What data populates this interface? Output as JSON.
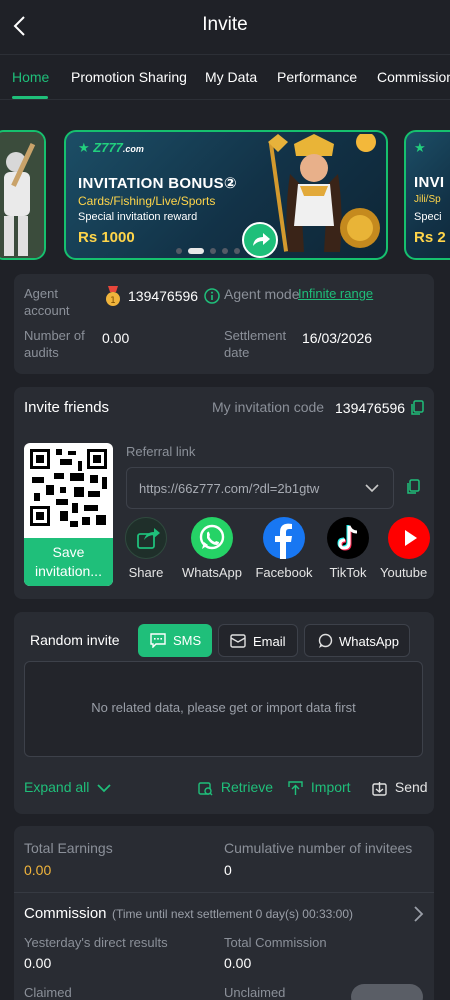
{
  "header": {
    "title": "Invite"
  },
  "tabs": [
    "Home",
    "Promotion Sharing",
    "My Data",
    "Performance",
    "Commission"
  ],
  "banner": {
    "brand": "Z777",
    "brand_suffix": ".com",
    "title": "INVITATION BONUS②",
    "categories": "Cards/Fishing/Live/Sports",
    "subtitle": "Special invitation reward",
    "amount": "Rs 1000",
    "right_title": "INVI",
    "right_sub": "Jili/Sp",
    "right_note": "Speci",
    "right_amount": "Rs 2"
  },
  "agent": {
    "account_label": "Agent account",
    "account_value": "139476596",
    "mode_label": "Agent mode",
    "mode_value": "Infinite range",
    "audits_label": "Number of audits",
    "audits_value": "0.00",
    "settlement_label": "Settlement date",
    "settlement_value": "16/03/2026"
  },
  "invite": {
    "title": "Invite friends",
    "code_label": "My invitation code",
    "code_value": "139476596",
    "save_label": "Save invitation...",
    "referral_label": "Referral link",
    "referral_value": "https://66z777.com/?dl=2b1gtw",
    "share_targets": [
      "Share",
      "WhatsApp",
      "Facebook",
      "TikTok",
      "Youtube"
    ]
  },
  "random": {
    "label": "Random invite",
    "channels": [
      "SMS",
      "Email",
      "WhatsApp"
    ],
    "empty_text": "No related data, please get or import data first",
    "expand": "Expand all",
    "retrieve": "Retrieve",
    "import": "Import",
    "send": "Send"
  },
  "earnings": {
    "total_label": "Total Earnings",
    "total_value": "0.00",
    "invitees_label": "Cumulative number of invitees",
    "invitees_value": "0",
    "commission_title": "Commission",
    "commission_note": "(Time until next settlement  0 day(s) 00:33:00)",
    "yesterday_label": "Yesterday's direct results",
    "yesterday_value": "0.00",
    "total_comm_label": "Total Commission",
    "total_comm_value": "0.00",
    "claimed_label": "Claimed",
    "unclaimed_label": "Unclaimed"
  },
  "colors": {
    "accent": "#1fbf7a",
    "gold": "#f0b43c",
    "bg": "#1f2127",
    "panel": "#292c33"
  }
}
